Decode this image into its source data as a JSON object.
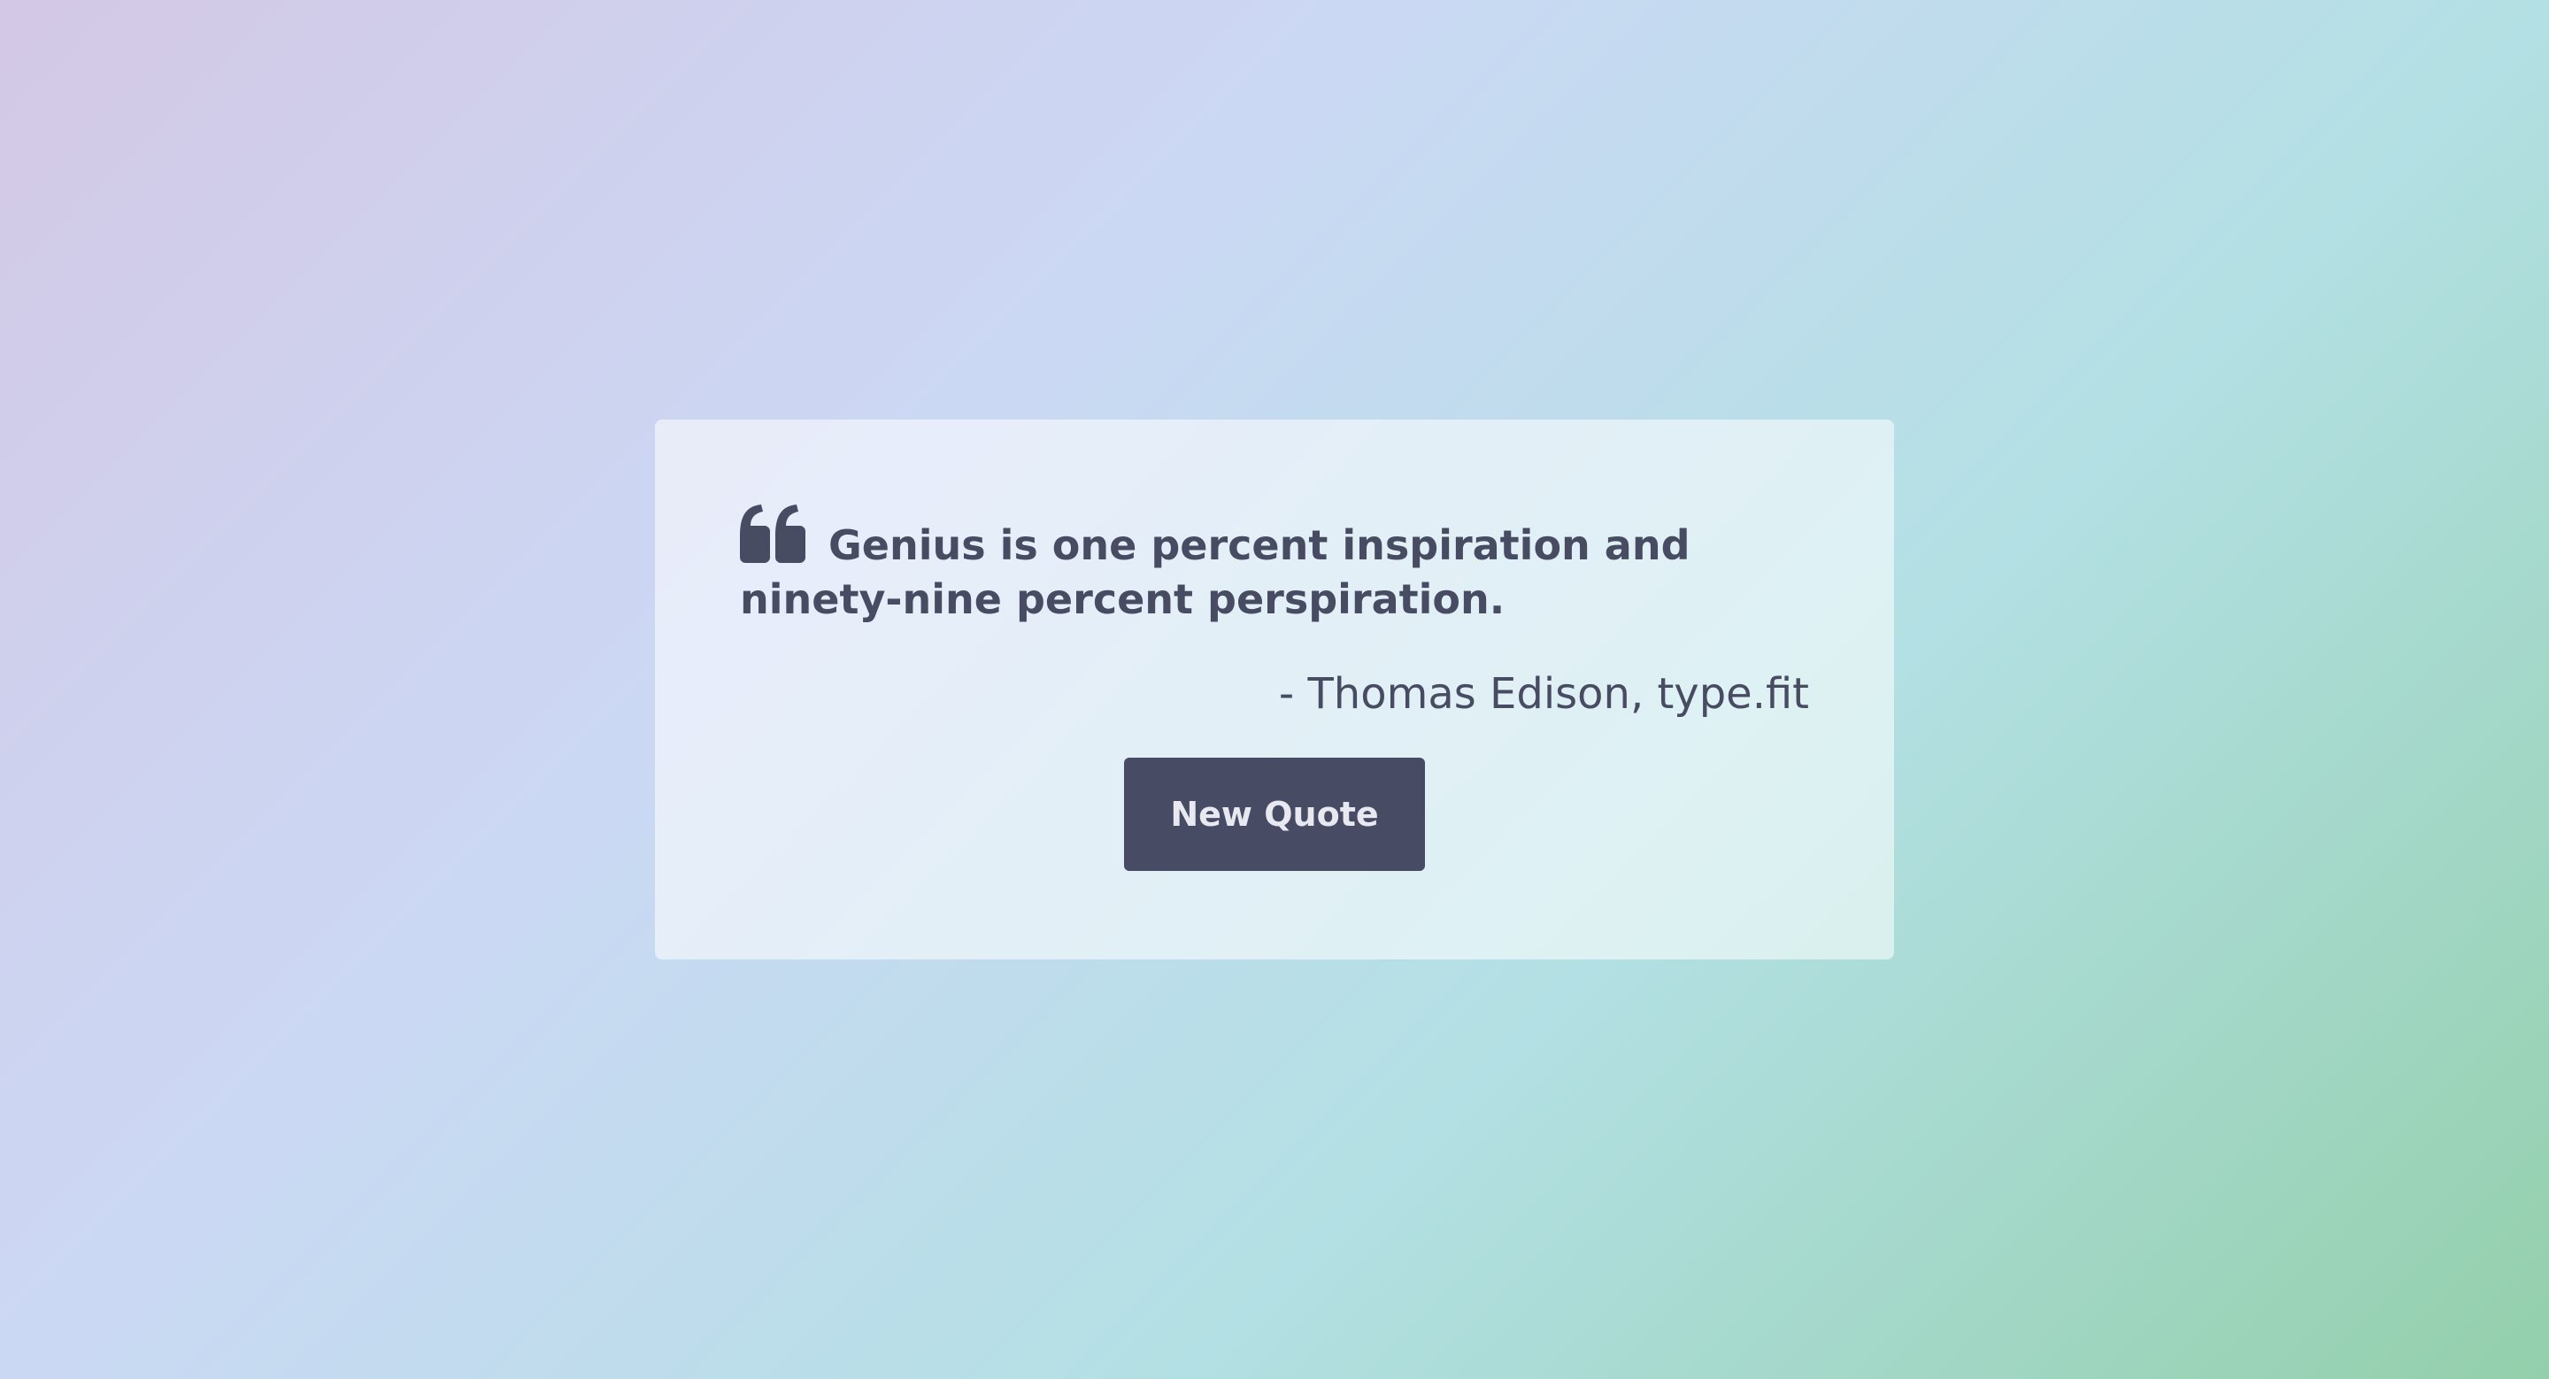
{
  "quote": {
    "icon": "quote-left-icon",
    "text": "Genius is one percent inspiration and ninety-nine percent perspiration.",
    "author_line": "- Thomas Edison, type.fit"
  },
  "actions": {
    "new_quote_label": "New Quote"
  },
  "colors": {
    "text": "#474c63",
    "button_bg": "#474b63",
    "button_text": "#e7e8f0",
    "card_bg": "rgba(255,255,255,0.55)",
    "gradient": [
      "#d3c8e5",
      "#cbd8f4",
      "#b3e0e4",
      "#93cfab"
    ]
  }
}
